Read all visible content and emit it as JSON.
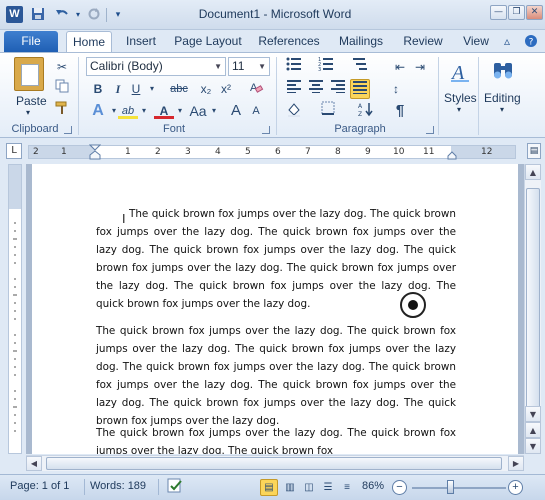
{
  "window": {
    "app_icon": "W",
    "title": "Document1 - Microsoft Word"
  },
  "quick_access": {
    "save_icon": "save-icon",
    "undo_icon": "undo-icon",
    "redo_icon": "redo-icon",
    "customize_icon": "customize-qat-icon"
  },
  "tabs": {
    "file": "File",
    "home": "Home",
    "insert": "Insert",
    "page_layout": "Page Layout",
    "references": "References",
    "mailings": "Mailings",
    "review": "Review",
    "view": "View"
  },
  "ribbon": {
    "clipboard": {
      "label": "Clipboard",
      "paste": "Paste"
    },
    "font": {
      "label": "Font",
      "font_name": "Calibri (Body)",
      "font_size": "11",
      "bold": "B",
      "italic": "I",
      "underline": "U",
      "strikethrough": "abc",
      "subscript": "x₂",
      "superscript": "x²",
      "grow": "A",
      "shrink": "A",
      "change_case": "Aa",
      "text_effects": "A",
      "highlight": "ab",
      "font_color": "A"
    },
    "paragraph": {
      "label": "Paragraph",
      "show_hide": "¶"
    },
    "styles": {
      "label": "Styles"
    },
    "editing": {
      "label": "Editing"
    }
  },
  "ruler": {
    "tab_selector": "L",
    "numbers": [
      "2",
      "1",
      "1",
      "2",
      "3",
      "4",
      "5",
      "6",
      "7",
      "8",
      "9",
      "10",
      "11",
      "12"
    ]
  },
  "document": {
    "paragraphs": [
      "The quick brown fox jumps over the lazy dog. The quick brown fox jumps over the lazy dog. The quick brown fox jumps over the lazy dog. The quick brown fox jumps over the lazy dog. The quick brown fox jumps over the lazy dog. The quick brown fox jumps over the lazy dog. The quick brown fox jumps over the lazy dog. The quick brown fox jumps over the lazy dog.",
      "The quick brown fox jumps over the lazy dog. The quick brown fox jumps over the lazy dog. The quick brown fox jumps over the lazy dog. The quick brown fox jumps over the lazy dog. The quick brown fox jumps over the lazy dog. The quick brown fox jumps over the lazy dog. The quick brown fox jumps over the lazy dog. The quick brown fox jumps over the lazy dog.",
      "The quick brown fox jumps over the lazy dog. The quick brown fox jumps over the lazy dog. The quick brown fox"
    ]
  },
  "statusbar": {
    "page": "Page: 1 of 1",
    "words": "Words: 189",
    "zoom": "86%",
    "zoom_level": 0.86
  },
  "colors": {
    "file_tab": "#2b65b8",
    "highlight_selected": "#fbd55a",
    "chrome_bg": "#dfe9f5"
  }
}
